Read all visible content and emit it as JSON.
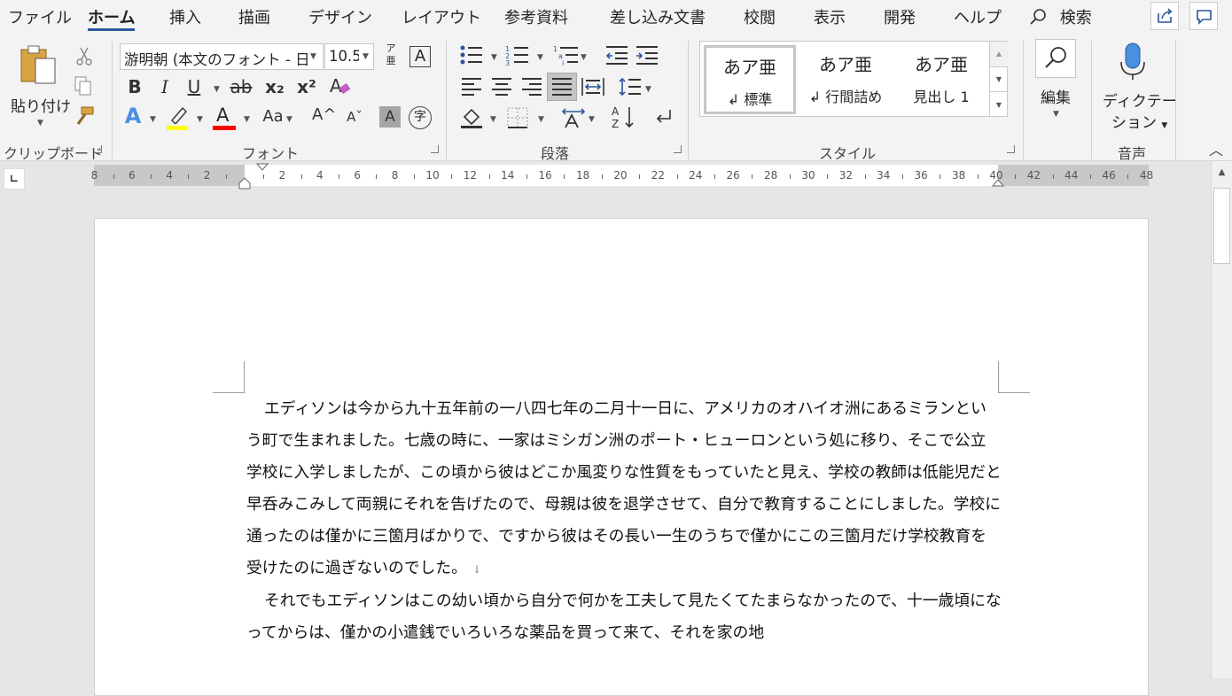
{
  "tabs": [
    "ファイル",
    "ホーム",
    "挿入",
    "描画",
    "デザイン",
    "レイアウト",
    "参考資料",
    "差し込み文書",
    "校閲",
    "表示",
    "開発",
    "ヘルプ"
  ],
  "search_label": "検索",
  "clipboard": {
    "paste_label": "貼り付け",
    "group_label": "クリップボード"
  },
  "font": {
    "font_name": "游明朝 (本文のフォント - 日",
    "font_size": "10.5",
    "group_label": "フォント",
    "phonetic_top": "ア",
    "phonetic_bottom": "亜",
    "bold": "B",
    "italic": "I",
    "underline": "U",
    "strike": "ab",
    "subscript": "x₂",
    "superscript": "x²",
    "text_effect": "A",
    "font_color": "A",
    "char_shading": "A",
    "case": "Aa",
    "grow": "A^",
    "shrink": "Aˇ",
    "enclose": "字"
  },
  "paragraph": {
    "group_label": "段落"
  },
  "styles": {
    "group_label": "スタイル",
    "items": [
      {
        "sample": "あア亜",
        "name": "標準"
      },
      {
        "sample": "あア亜",
        "name": "行間詰め"
      },
      {
        "sample": "あア亜",
        "name": "見出し 1"
      }
    ]
  },
  "editing": {
    "label": "編集"
  },
  "voice": {
    "label_line1": "ディクテー",
    "label_line2": "ション",
    "group_label": "音声"
  },
  "ruler": {
    "left_numbers": [
      "8",
      "6",
      "4",
      "2"
    ],
    "right_numbers": [
      "2",
      "4",
      "6",
      "8",
      "10",
      "12",
      "14",
      "16",
      "18",
      "20",
      "22",
      "24",
      "26",
      "28",
      "30",
      "32",
      "34",
      "36",
      "38",
      "40",
      "42",
      "44",
      "46",
      "48"
    ]
  },
  "document": {
    "paragraphs": [
      "エディソンは今から九十五年前の一八四七年の二月十一日に、アメリカのオハイオ洲にあるミランという町で生まれました。七歳の時に、一家はミシガン洲のポート・ヒューロンという処に移り、そこで公立学校に入学しましたが、この頃から彼はどこか風変りな性質をもっていたと見え、学校の教師は低能児だと早呑みこみして両親にそれを告げたので、母親は彼を退学させて、自分で教育することにしました。学校に通ったのは僅かに三箇月ばかりで、ですから彼はその長い一生のうちで僅かにこの三箇月だけ学校教育を受けたのに過ぎないのでした。",
      "それでもエディソンはこの幼い頃から自分で何かを工夫して見たくてたまらなかったので、十一歳頃になってからは、僅かの小遣銭でいろいろな薬品を買って来て、それを家の地"
    ],
    "paragraph_mark": "↓"
  },
  "colors": {
    "accent": "#2b579a",
    "highlight": "#ffff00",
    "font_color": "#ff0000",
    "ribbon_bg": "#f3f3f3"
  }
}
